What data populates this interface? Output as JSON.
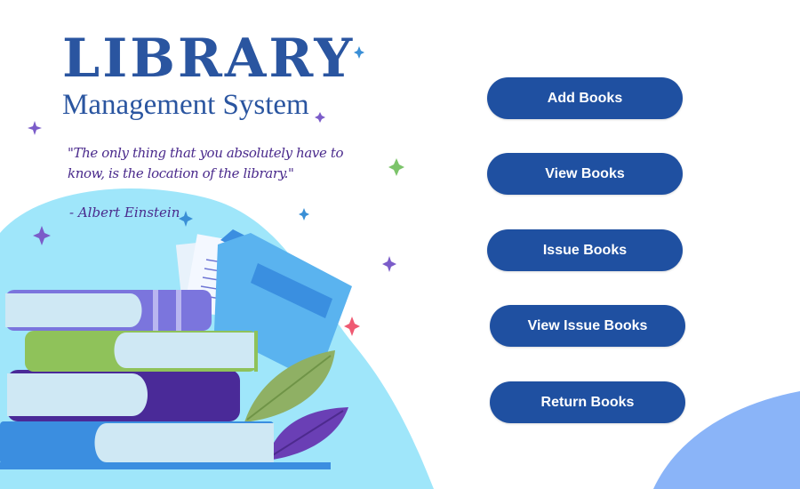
{
  "app": {
    "title": "LIBRARY",
    "subtitle": "Management System"
  },
  "quote": {
    "text": "\"The only thing that you absolutely have to know, is the location of the library.\"",
    "author": "- Albert Einstein"
  },
  "menu": {
    "add_books": "Add Books",
    "view_books": "View Books",
    "issue_books": "Issue Books",
    "view_issue_books": "View Issue Books",
    "return_books": "Return Books"
  },
  "colors": {
    "primary": "#1f50a1",
    "title": "#2a55a0",
    "quote_text": "#4a2a8c",
    "blob_cyan": "#9fe6fa",
    "blob_corner": "#8ab4f8"
  },
  "decor": {
    "illustration": "book-stack-illustration",
    "sparkles": "sparkle-icon"
  }
}
